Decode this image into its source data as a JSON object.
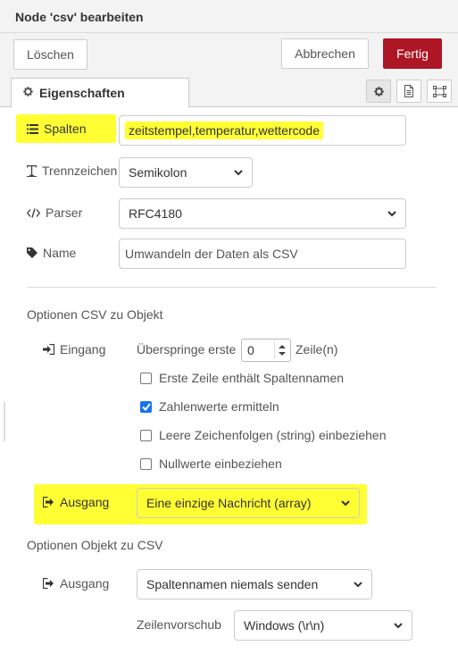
{
  "tray": {
    "title": "Node 'csv' bearbeiten",
    "delete_label": "Löschen",
    "cancel_label": "Abbrechen",
    "done_label": "Fertig"
  },
  "tabs": {
    "properties_label": "Eigenschaften",
    "icons": [
      "gear-icon",
      "description-icon",
      "appearance-icon"
    ]
  },
  "form": {
    "columns": {
      "label": "Spalten",
      "value": "zeitstempel,temperatur,wettercode"
    },
    "separator": {
      "label": "Trennzeichen",
      "value": "Semikolon"
    },
    "parser": {
      "label": "Parser",
      "value": "RFC4180"
    },
    "name": {
      "label": "Name",
      "value": "Umwandeln der Daten als CSV"
    }
  },
  "csv_to_object": {
    "title": "Optionen CSV zu Objekt",
    "input_label": "Eingang",
    "skip_prefix": "Überspringe erste",
    "skip_value": "0",
    "skip_suffix": "Zeile(n)",
    "options": [
      {
        "label": "Erste Zeile enthält Spaltennamen",
        "checked": false
      },
      {
        "label": "Zahlenwerte ermitteln",
        "checked": true
      },
      {
        "label": "Leere Zeichenfolgen (string) einbeziehen",
        "checked": false
      },
      {
        "label": "Nullwerte einbeziehen",
        "checked": false
      }
    ],
    "output_label": "Ausgang",
    "output_value": "Eine einzige Nachricht (array)"
  },
  "object_to_csv": {
    "title": "Optionen Objekt zu CSV",
    "output_label": "Ausgang",
    "output_value": "Spaltennamen niemals senden",
    "newline_label": "Zeilenvorschub",
    "newline_value": "Windows (\\r\\n)"
  },
  "colors": {
    "highlight": "#ffff33",
    "primary_button": "#ad1625",
    "checkbox_checked": "#1a73e8"
  }
}
